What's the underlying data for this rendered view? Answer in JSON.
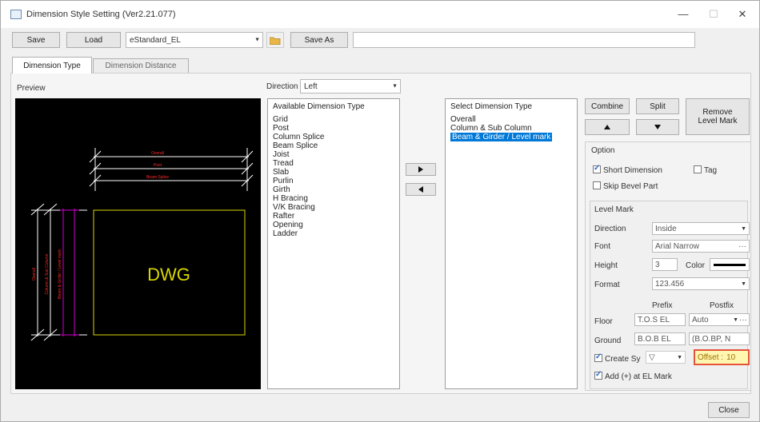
{
  "window": {
    "title": "Dimension Style Setting (Ver2.21.077)",
    "minimize": "—",
    "maximize": "☐",
    "close": "✕"
  },
  "toolbar": {
    "save_label": "Save",
    "load_label": "Load",
    "style_value": "eStandard_EL",
    "save_as_label": "Save As",
    "save_as_value": ""
  },
  "tabs": [
    {
      "label": "Dimension Type",
      "active": true
    },
    {
      "label": "Dimension Distance",
      "active": false
    }
  ],
  "preview": {
    "label": "Preview",
    "dwg_text": "DWG"
  },
  "direction": {
    "label": "Direction",
    "value": "Left"
  },
  "available": {
    "header": "Available Dimension Type",
    "items": [
      "Grid",
      "Post",
      "Column Splice",
      "Beam Splice",
      "Joist",
      "Tread",
      "Slab",
      "Purlin",
      "Girth",
      "H Bracing",
      "V/K Bracing",
      "Rafter",
      "Opening",
      "Ladder"
    ]
  },
  "transfer": {
    "add_icon": "triangle-right-icon",
    "remove_icon": "triangle-left-icon"
  },
  "selected": {
    "header": "Select Dimension Type",
    "items": [
      "Overall",
      "Column & Sub Column",
      "Beam & Girder / Level mark"
    ],
    "selected_index": 2
  },
  "actions": {
    "combine_label": "Combine",
    "split_label": "Split",
    "up_icon": "triangle-up-icon",
    "down_icon": "triangle-down-icon",
    "remove_label_line1": "Remove",
    "remove_label_line2": "Level Mark"
  },
  "option": {
    "title": "Option",
    "short_dimension": "Short Dimension",
    "short_dimension_checked": true,
    "tag": "Tag",
    "tag_checked": false,
    "skip_bevel": "Skip Bevel Part",
    "skip_bevel_checked": false
  },
  "level_mark": {
    "title": "Level Mark",
    "direction_label": "Direction",
    "direction_value": "Inside",
    "font_label": "Font",
    "font_value": "Arial Narrow",
    "height_label": "Height",
    "height_value": "3",
    "color_label": "Color",
    "color_value": "#000000",
    "format_label": "Format",
    "format_value": "123.456",
    "prefix_header": "Prefix",
    "postfix_header": "Postfix",
    "floor_label": "Floor",
    "floor_prefix": "T.O.S EL",
    "floor_postfix": "Auto",
    "ground_label": "Ground",
    "ground_prefix": "B.O.B EL",
    "ground_postfix": "(B.O.BP, N",
    "create_sym_label": "Create Sy",
    "create_sym_checked": true,
    "create_sym_value": "▽",
    "offset_label": "Offset :",
    "offset_value": "10",
    "add_plus_label": "Add (+) at EL Mark",
    "add_plus_checked": true
  },
  "footer": {
    "close_label": "Close"
  },
  "colors": {
    "highlight": "#0078d7",
    "offset_bg": "#fff6b0",
    "offset_border": "#e5533b",
    "dwg_yellow": "#d8d800",
    "dim_white": "#ffffff",
    "dim_red": "#ff2a2a",
    "dim_magenta": "#d000d0"
  }
}
